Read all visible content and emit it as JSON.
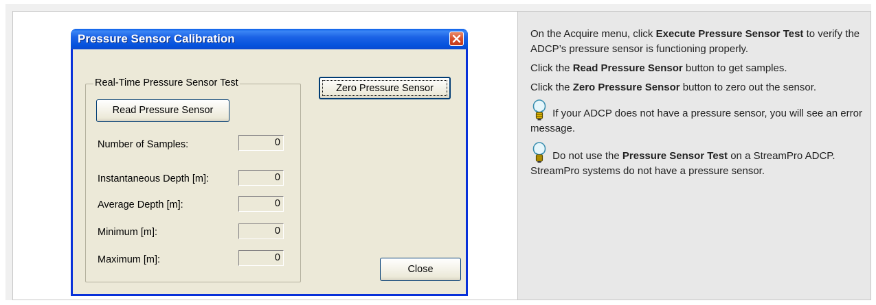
{
  "dialog": {
    "title": "Pressure Sensor Calibration",
    "group_label": "Real-Time Pressure Sensor Test",
    "read_button": "Read Pressure Sensor",
    "zero_button": "Zero Pressure Sensor",
    "close_button": "Close",
    "fields": [
      {
        "label": "Number of Samples:",
        "value": "0"
      },
      {
        "label": "Instantaneous Depth [m]:",
        "value": "0"
      },
      {
        "label": "Average Depth [m]:",
        "value": "0"
      },
      {
        "label": "Minimum [m]:",
        "value": "0"
      },
      {
        "label": "Maximum [m]:",
        "value": "0"
      }
    ]
  },
  "help": {
    "p1_pre": "On the Acquire menu, click ",
    "p1_bold": "Execute Pressure Sensor Test",
    "p1_post": " to verify the ADCP’s pressure sensor is functioning properly.",
    "p2_pre": "Click the ",
    "p2_bold": "Read Pressure Sensor",
    "p2_post": " button to get samples.",
    "p3_pre": "Click the ",
    "p3_bold": "Zero Pressure Sensor",
    "p3_post": " button to zero out the sensor.",
    "tip1": " If your ADCP does not have a pressure sensor, you will see an error message.",
    "tip2_pre": " Do not use the ",
    "tip2_bold": "Pressure Sensor Test",
    "tip2_post": " on a StreamPro ADCP. StreamPro systems do not have a pressure sensor.",
    "icon": "lightbulb-icon"
  },
  "colors": {
    "title_bar": "#0553dd",
    "dialog_bg": "#ece9d8",
    "help_bg": "#e8e8e8"
  }
}
